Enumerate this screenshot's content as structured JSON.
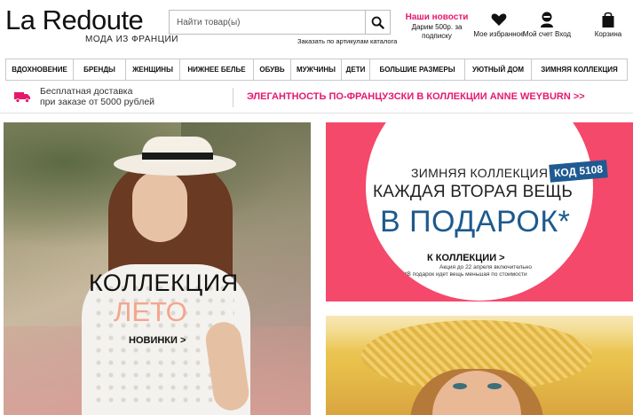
{
  "brand": {
    "logo_text": "La Redoute",
    "logo_sub": "МОДА ИЗ ФРАНЦИИ"
  },
  "search": {
    "placeholder": "Найти товар(ы)",
    "catalog_link": "Заказать по артикулам каталога"
  },
  "promo": {
    "title": "Наши новости",
    "text": "Дарим 500р. за подписку"
  },
  "header_icons": [
    {
      "icon": "heart-icon",
      "label": "Мое избранное"
    },
    {
      "icon": "user-icon",
      "label": "Мой счет Вход"
    },
    {
      "icon": "bag-icon",
      "label": "Корзина"
    }
  ],
  "nav": {
    "items": [
      "ВДОХНОВЕНИЕ",
      "БРЕНДЫ",
      "ЖЕНЩИНЫ",
      "НИЖНЕЕ БЕЛЬЕ",
      "ОБУВЬ",
      "МУЖЧИНЫ",
      "ДЕТИ",
      "БОЛЬШИЕ РАЗМЕРЫ",
      "УЮТНЫЙ ДОМ",
      "ЗИМНЯЯ КОЛЛЕКЦИЯ"
    ]
  },
  "delivery": {
    "line1": "Бесплатная доставка",
    "line2": "при заказе от 5000 рублей"
  },
  "campaign": {
    "text": "ЭЛЕГАНТНОСТЬ ПО-ФРАНЦУЗСКИ В КОЛЛЕКЦИИ ANNE WEYBURN >>"
  },
  "banner_left": {
    "title": "КОЛЛЕКЦИЯ",
    "subtitle": "ЛЕТО",
    "cta": "НОВИНКИ >"
  },
  "banner_right": {
    "line1": "ЗИМНЯЯ КОЛЛЕКЦИЯ",
    "code": "КОД 5108",
    "line2": "КАЖДАЯ ВТОРАЯ ВЕЩЬ",
    "line3": "В ПОДАРОК*",
    "cta": "К КОЛЛЕКЦИИ >",
    "note1": "Акция до 22 апреля включительно",
    "note2": "*В подарок идет вещь меньшая по стоимости"
  },
  "colors": {
    "accent_pink": "#e4196e",
    "banner_coral": "#f4496a",
    "banner_blue": "#1d5a8e",
    "code_badge": "#1f5a92",
    "peach_text": "#f3a68f"
  }
}
